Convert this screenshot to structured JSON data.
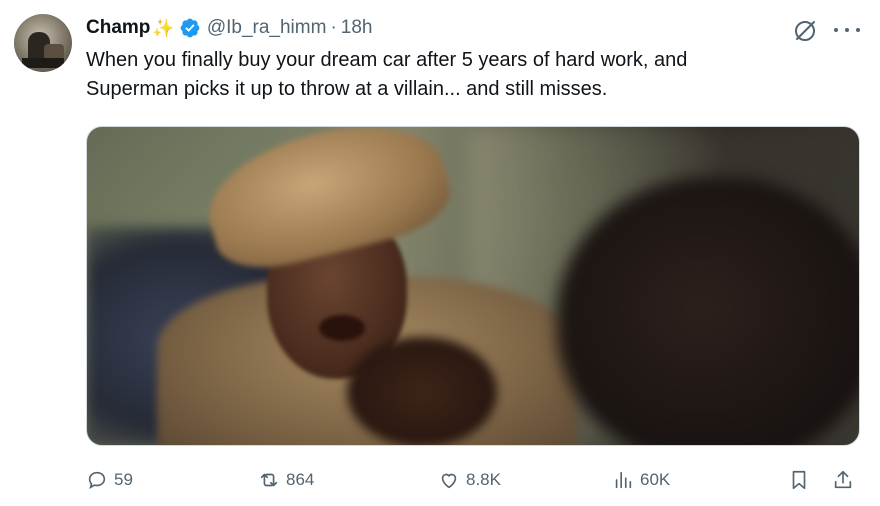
{
  "author": {
    "name": "Champ",
    "sparkle": "✨",
    "handle": "@Ib_ra_himm",
    "separator": "·",
    "time": "18h"
  },
  "tweet": {
    "line1": "When you finally buy your dream car after 5 years of hard work, and",
    "line2": "Superman picks it up to throw at a villain... and still misses."
  },
  "actions": {
    "replies": "59",
    "reposts": "864",
    "likes": "8.8K",
    "views": "60K"
  },
  "icons": {
    "verified": "verified-badge-icon",
    "grok": "grok-icon",
    "more": "more-icon",
    "reply": "reply-icon",
    "repost": "repost-icon",
    "like": "heart-icon",
    "views": "views-icon",
    "bookmark": "bookmark-icon",
    "share": "share-icon"
  },
  "colors": {
    "verified": "#1d9bf0",
    "secondary_text": "#536471",
    "primary_text": "#0f1419",
    "sparkle": "#f4b400"
  }
}
